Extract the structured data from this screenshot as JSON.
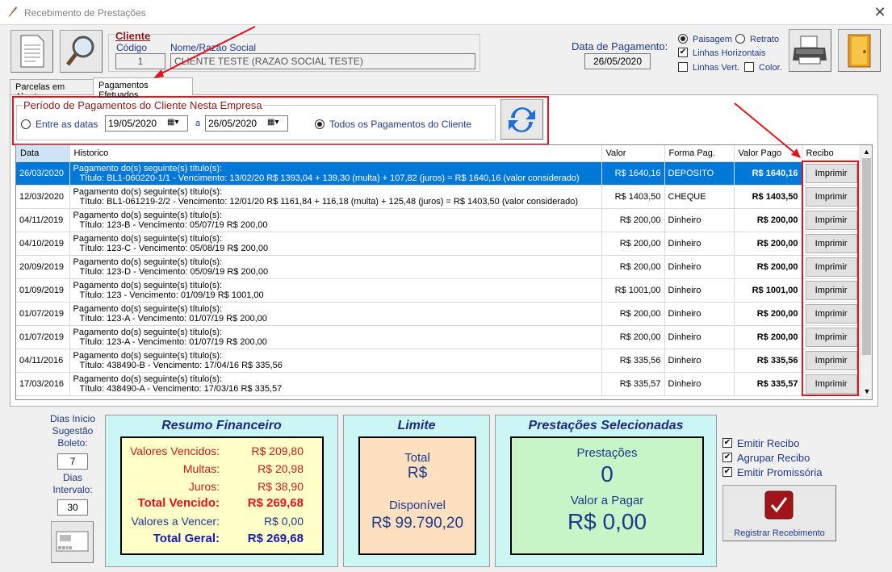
{
  "window": {
    "title": "Recebimento de Prestações",
    "close": "✕"
  },
  "client": {
    "section_label": "Cliente",
    "code_label": "Código",
    "name_label": "Nome/Razão Social",
    "code_value": "1",
    "name_value": "CLIENTE TESTE (RAZAO SOCIAL TESTE)"
  },
  "payment_date": {
    "label": "Data de Pagamento:",
    "value": "26/05/2020"
  },
  "print_options": {
    "landscape": "Paisagem",
    "portrait": "Retrato",
    "hlines": "Linhas Horizontais",
    "vlines": "Linhas Vert.",
    "color": "Color."
  },
  "tabs": [
    {
      "label": "Parcelas em Aberto"
    },
    {
      "label": "Pagamentos Efetuados"
    }
  ],
  "period": {
    "title": "Período de Pagamentos do Cliente Nesta Empresa",
    "between_label": "Entre as datas",
    "from": "19/05/2020",
    "to_label": "a",
    "to": "26/05/2020",
    "all_label": "Todos os Pagamentos do Cliente"
  },
  "grid": {
    "headers": [
      "Data",
      "Historico",
      "Valor",
      "Forma Pag.",
      "Valor Pago",
      "Recibo"
    ],
    "print_label": "Imprimir",
    "rows": [
      {
        "date": "26/03/2020",
        "h1": "Pagamento do(s) seguinte(s) título(s):",
        "h2": "Título: BL1-060220-1/1 - Vencimento: 13/02/20  R$ 1393,04 + 139,30 (multa) + 107,82 (juros) = R$ 1640,16 (valor considerado)",
        "value": "R$ 1640,16",
        "method": "DEPOSITO",
        "paid": "R$ 1640,16"
      },
      {
        "date": "12/03/2020",
        "h1": "Pagamento do(s) seguinte(s) título(s):",
        "h2": "Título: BL1-061219-2/2 - Vencimento: 12/01/20  R$ 1161,84 + 116,18 (multa) + 125,48 (juros) = R$ 1403,50 (valor considerado)",
        "value": "R$ 1403,50",
        "method": "CHEQUE",
        "paid": "R$ 1403,50"
      },
      {
        "date": "04/11/2019",
        "h1": "Pagamento do(s) seguinte(s) título(s):",
        "h2": "Título: 123-B - Vencimento: 05/07/19  R$ 200,00",
        "value": "R$ 200,00",
        "method": "Dinheiro",
        "paid": "R$ 200,00"
      },
      {
        "date": "04/10/2019",
        "h1": "Pagamento do(s) seguinte(s) título(s):",
        "h2": "Título: 123-C - Vencimento: 05/08/19  R$ 200,00",
        "value": "R$ 200,00",
        "method": "Dinheiro",
        "paid": "R$ 200,00"
      },
      {
        "date": "20/09/2019",
        "h1": "Pagamento do(s) seguinte(s) título(s):",
        "h2": "Título: 123-D - Vencimento: 05/09/19  R$ 200,00",
        "value": "R$ 200,00",
        "method": "Dinheiro",
        "paid": "R$ 200,00"
      },
      {
        "date": "01/09/2019",
        "h1": "Pagamento do(s) seguinte(s) título(s):",
        "h2": "Título: 123 - Vencimento: 01/09/19  R$ 1001,00",
        "value": "R$ 1001,00",
        "method": "Dinheiro",
        "paid": "R$ 1001,00"
      },
      {
        "date": "01/07/2019",
        "h1": "Pagamento do(s) seguinte(s) título(s):",
        "h2": "Título: 123-A - Vencimento: 01/07/19  R$ 200,00",
        "value": "R$ 200,00",
        "method": "Dinheiro",
        "paid": "R$ 200,00"
      },
      {
        "date": "01/07/2019",
        "h1": "Pagamento do(s) seguinte(s) título(s):",
        "h2": "Título: 123-A - Vencimento: 01/07/19  R$ 200,00",
        "value": "R$ 200,00",
        "method": "Dinheiro",
        "paid": "R$ 200,00"
      },
      {
        "date": "04/11/2016",
        "h1": "Pagamento do(s) seguinte(s) título(s):",
        "h2": "Título: 438490-B - Vencimento: 17/04/16  R$ 335,56",
        "value": "R$ 335,56",
        "method": "Dinheiro",
        "paid": "R$ 335,56"
      },
      {
        "date": "17/03/2016",
        "h1": "Pagamento do(s) seguinte(s) título(s):",
        "h2": "Título: 438490-A - Vencimento: 17/03/16  R$ 335,57",
        "value": "R$ 335,57",
        "method": "Dinheiro",
        "paid": "R$ 335,57"
      }
    ]
  },
  "suggest": {
    "l1": "Dias Início",
    "l2": "Sugestão",
    "l3": "Boleto:",
    "boleto_days": "7",
    "l4": "Dias",
    "l5": "Intervalo:",
    "interval": "30"
  },
  "resumo": {
    "title": "Resumo Financeiro",
    "vencidos_l": "Valores Vencidos:",
    "vencidos": "R$ 209,80",
    "multas_l": "Multas:",
    "multas": "R$ 20,98",
    "juros_l": "Juros:",
    "juros": "R$ 38,90",
    "tv_l": "Total Vencido:",
    "tv": "R$ 269,68",
    "av_l": "Valores a Vencer:",
    "av": "R$ 0,00",
    "tg_l": "Total Geral:",
    "tg": "R$ 269,68"
  },
  "limite": {
    "title": "Limite",
    "total_l": "Total",
    "total": "R$",
    "disp_l": "Disponível",
    "disp": "R$ 99.790,20"
  },
  "prest": {
    "title": "Prestações Selecionadas",
    "count_l": "Prestações",
    "count": "0",
    "pay_l": "Valor a Pagar",
    "pay": "R$ 0,00"
  },
  "options": {
    "recibo": "Emitir Recibo",
    "agrupar": "Agrupar Recibo",
    "promissoria": "Emitir Promissória"
  },
  "register": {
    "label": "Registrar Recebimento"
  }
}
